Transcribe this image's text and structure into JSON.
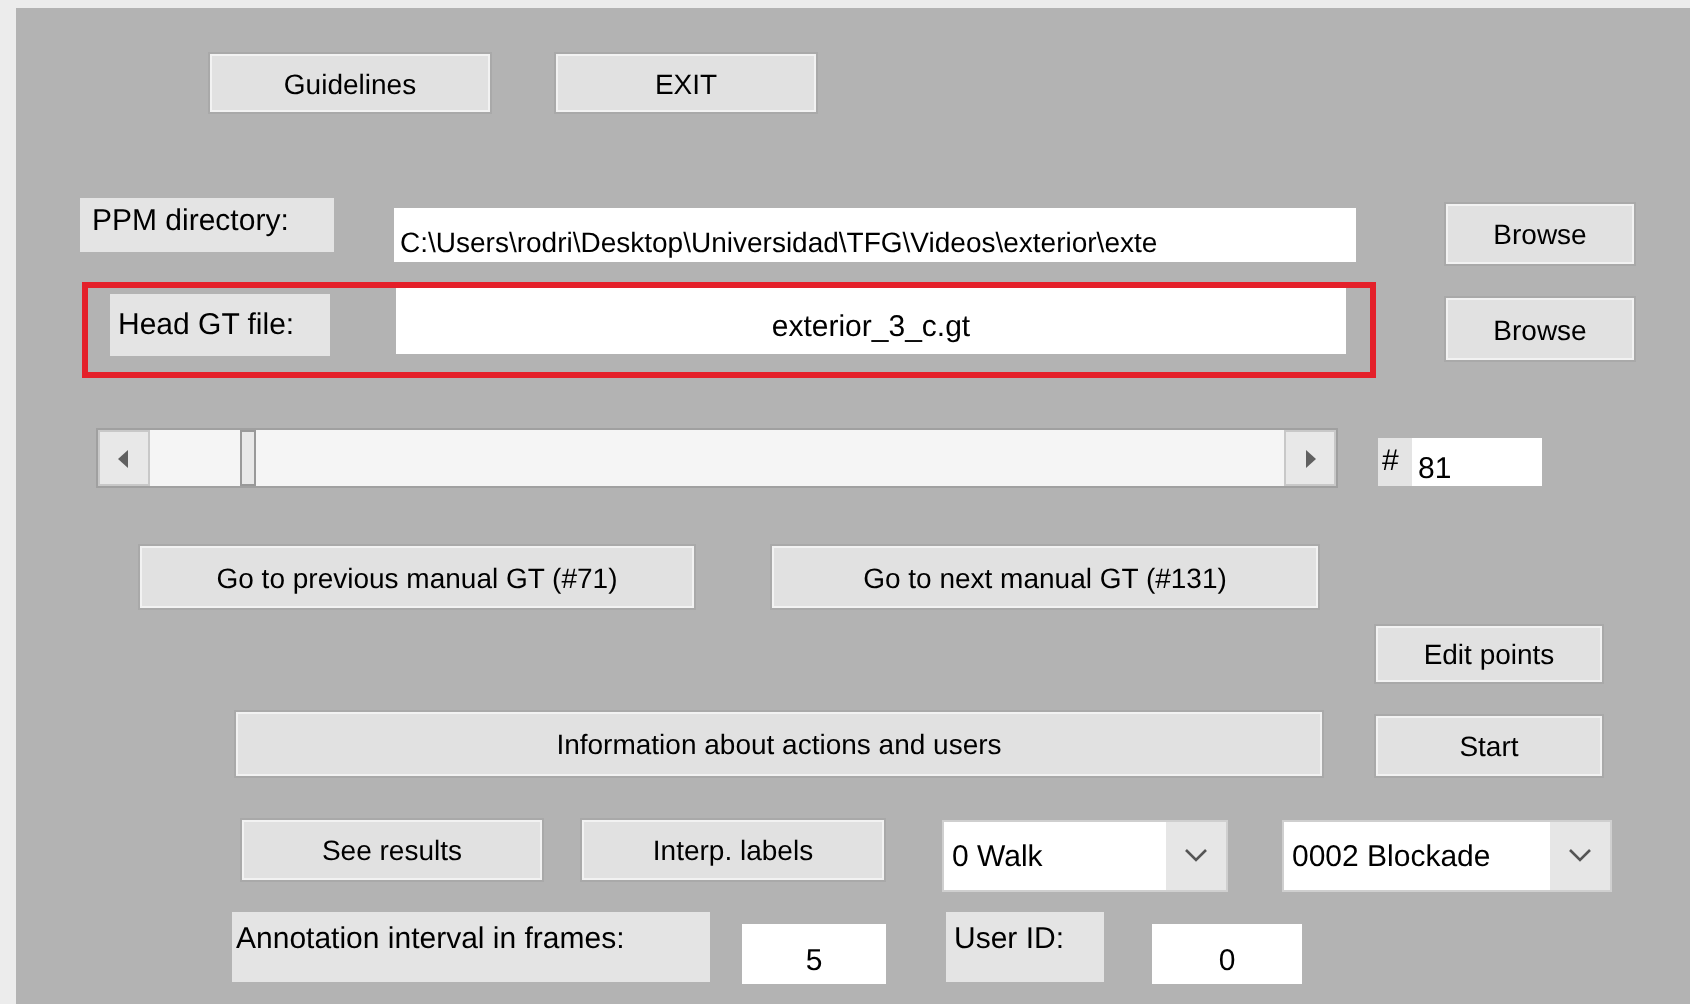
{
  "top_buttons": [
    {
      "label": "Guidelines"
    },
    {
      "label": "EXIT"
    }
  ],
  "ppm_directory": {
    "label": "PPM directory:",
    "value": "C:\\Users\\rodri\\Desktop\\Universidad\\TFG\\Videos\\exterior\\exte",
    "button": "Browse"
  },
  "head_gt_file": {
    "label": "Head GT file:",
    "value": "exterior_3_c.gt",
    "button": "Browse",
    "highlighted": true
  },
  "frame_slider": {
    "level": 0.08,
    "prefix": "#",
    "value": "81"
  },
  "navigation": [
    {
      "label": "Go to previous manual GT (#71)"
    },
    {
      "label": "Go to next manual GT (#131)"
    }
  ],
  "edit_points": "Edit points",
  "information": "Information about actions and users",
  "start": "Start",
  "see_results": "See results",
  "interp_labels": "Interp. labels",
  "action_dropdown": {
    "value": "0 Walk"
  },
  "user_dropdown": {
    "value": "0002 Blockade"
  },
  "annotation_interval": {
    "label": "Annotation interval in frames:",
    "value": "5"
  },
  "user_id": {
    "label": "User ID:",
    "value": "0"
  }
}
